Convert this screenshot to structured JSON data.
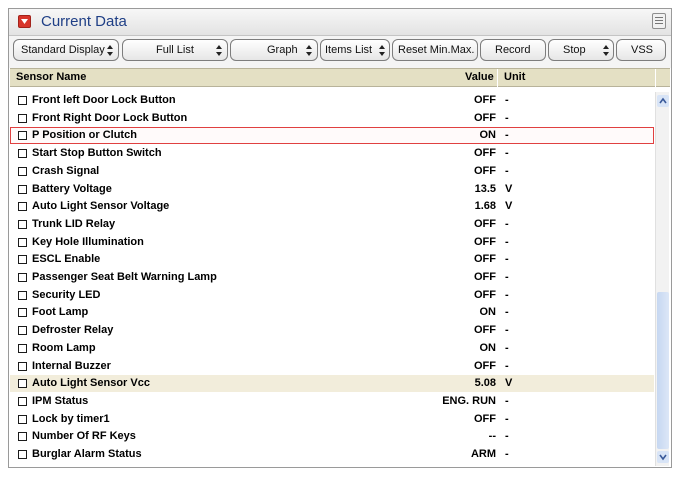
{
  "window": {
    "title": "Current Data",
    "title_icon": "collapse-arrow-icon",
    "menu_icon": "panel-menu-icon"
  },
  "toolbar": {
    "standard_display": "Standard Display",
    "full_list": "Full List",
    "graph": "Graph",
    "items_list": "Items List",
    "reset_min_max": "Reset Min.Max.",
    "record": "Record",
    "stop": "Stop",
    "vss": "VSS"
  },
  "columns": {
    "sensor": "Sensor Name",
    "value": "Value",
    "unit": "Unit"
  },
  "rows": [
    {
      "name": "Front left Door Lock Button",
      "value": "OFF",
      "unit": "-"
    },
    {
      "name": "Front Right Door Lock Button",
      "value": "OFF",
      "unit": "-"
    },
    {
      "name": "P Position or Clutch",
      "value": "ON",
      "unit": "-"
    },
    {
      "name": "Start Stop Button Switch",
      "value": "OFF",
      "unit": "-"
    },
    {
      "name": "Crash Signal",
      "value": "OFF",
      "unit": "-"
    },
    {
      "name": "Battery Voltage",
      "value": "13.5",
      "unit": "V"
    },
    {
      "name": "Auto Light Sensor Voltage",
      "value": "1.68",
      "unit": "V"
    },
    {
      "name": "Trunk LID Relay",
      "value": "OFF",
      "unit": "-"
    },
    {
      "name": "Key Hole Illumination",
      "value": "OFF",
      "unit": "-"
    },
    {
      "name": "ESCL Enable",
      "value": "OFF",
      "unit": "-"
    },
    {
      "name": "Passenger Seat Belt Warning Lamp",
      "value": "OFF",
      "unit": "-"
    },
    {
      "name": "Security LED",
      "value": "OFF",
      "unit": "-"
    },
    {
      "name": "Foot Lamp",
      "value": "ON",
      "unit": "-"
    },
    {
      "name": "Defroster Relay",
      "value": "OFF",
      "unit": "-"
    },
    {
      "name": "Room Lamp",
      "value": "ON",
      "unit": "-"
    },
    {
      "name": "Internal Buzzer",
      "value": "OFF",
      "unit": "-"
    },
    {
      "name": "Auto Light Sensor Vcc",
      "value": "5.08",
      "unit": "V"
    },
    {
      "name": "IPM Status",
      "value": "ENG. RUN",
      "unit": "-"
    },
    {
      "name": "Lock by timer1",
      "value": "OFF",
      "unit": "-"
    },
    {
      "name": "Number Of RF Keys",
      "value": "--",
      "unit": "-"
    },
    {
      "name": "Burglar Alarm Status",
      "value": "ARM",
      "unit": "-"
    }
  ],
  "highlighted_row": "P Position or Clutch",
  "selected_row": "Auto Light Sensor Vcc",
  "colors": {
    "title_text": "#1f3f86",
    "title_icon": "#d8352b",
    "header_bg": "#e4e0c4",
    "highlight_border": "#e04040",
    "selected_row_bg": "#f2eddb",
    "scroll_thumb": "#c6d7f1"
  }
}
